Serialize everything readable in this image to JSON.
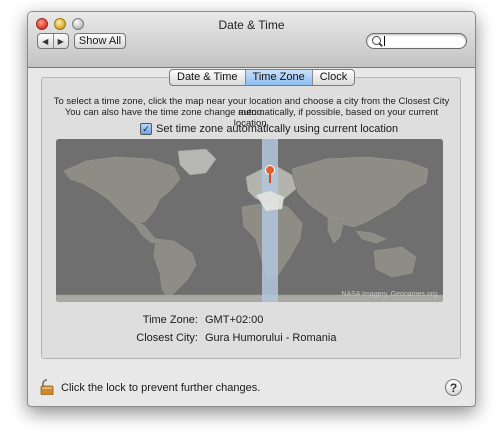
{
  "window": {
    "title": "Date & Time"
  },
  "toolbar": {
    "back_icon": "chevron-left-icon",
    "forward_icon": "chevron-right-icon",
    "show_all_label": "Show All",
    "search_value": "",
    "search_icon": "search-icon"
  },
  "tabs": [
    {
      "label": "Date & Time",
      "selected": false
    },
    {
      "label": "Time Zone",
      "selected": true
    },
    {
      "label": "Clock",
      "selected": false
    }
  ],
  "time_zone": {
    "instructions_line1": "To select a time zone, click the map near your location and choose a city from the Closest City menu.",
    "instructions_line2": "You can also have the time zone change automatically, if possible, based on your current location.",
    "auto_checkbox_label": "Set time zone automatically using current location",
    "auto_checked": true,
    "map_credit": "NASA Imagery, Geonames.org",
    "time_zone_label": "Time Zone:",
    "time_zone_value": "GMT+02:00",
    "closest_city_label": "Closest City:",
    "closest_city_value": "Gura Humorului - Romania"
  },
  "footer": {
    "lock_message": "Click the lock to prevent further changes.",
    "help_label": "?"
  },
  "colors": {
    "selected_tab": "#8fbdf0",
    "timezone_band": "#b3c7dd",
    "location_pin": "#e0602a"
  }
}
